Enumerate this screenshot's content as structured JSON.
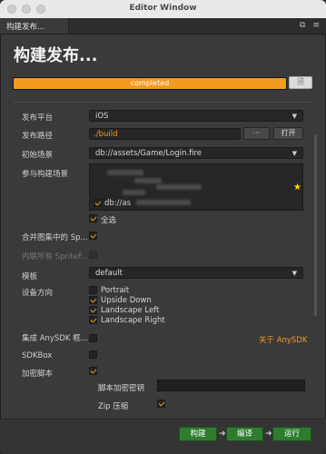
{
  "window": {
    "title": "Editor Window"
  },
  "tab": {
    "label": "构建发布..."
  },
  "heading": "构建发布...",
  "progress": {
    "text": "completed",
    "value": 1.0
  },
  "form": {
    "platform": {
      "label": "发布平台",
      "value": "iOS"
    },
    "path": {
      "label": "发布路径",
      "value": "./build",
      "dots": "···",
      "open": "打开"
    },
    "start_scene": {
      "label": "初始场景",
      "value": "db://assets/Game/Login.fire"
    },
    "scenes": {
      "label": "参与构建场景",
      "visible_item": "db://as",
      "select_all": "全选"
    },
    "merge": {
      "label": "合并图集中的 Sp..."
    },
    "inline": {
      "label": "内联所有 SpriteF..."
    },
    "template": {
      "label": "模板",
      "value": "default"
    },
    "orientation": {
      "label": "设备方向",
      "options": [
        "Portrait",
        "Upside Down",
        "Landscape Left",
        "Landscape Right"
      ],
      "checked": [
        false,
        true,
        true,
        true
      ]
    },
    "anysdk": {
      "label": "集成 AnySDK 框...",
      "link": "关于 AnySDK"
    },
    "sdkbox": {
      "label": "SDKBox"
    },
    "encrypt": {
      "label": "加密脚本",
      "key_label": "脚本加密密钥",
      "zip_label": "Zip 压缩"
    }
  },
  "footer": {
    "build": "构建",
    "compile": "编译",
    "run": "运行"
  }
}
